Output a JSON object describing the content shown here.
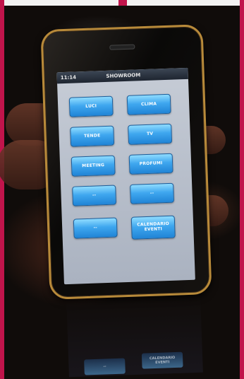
{
  "status_bar": {
    "time": "11:14",
    "title": "SHOWROOM"
  },
  "buttons": [
    "LUCI",
    "CLIMA",
    "TENDE",
    "TV",
    "MEETING",
    "PROFUMI",
    "--",
    "--",
    "--",
    "CALENDARIO EVENTI"
  ]
}
